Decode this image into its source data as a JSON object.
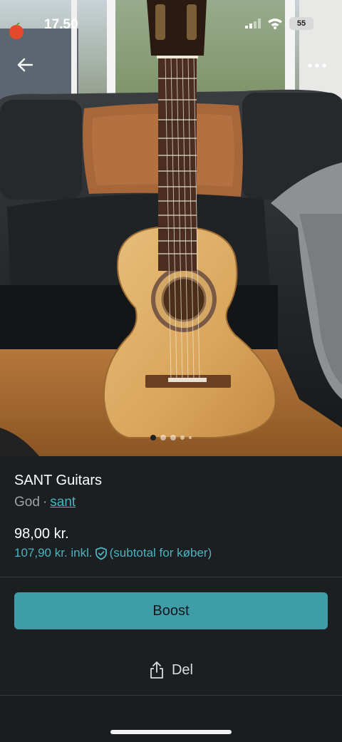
{
  "status_bar": {
    "time": "17.50",
    "battery": "55"
  },
  "nav": {
    "back_icon": "arrow-left-icon",
    "more_icon": "more-dots-icon"
  },
  "gallery": {
    "image_count": 5,
    "active_index": 0
  },
  "listing": {
    "title": "SANT Guitars",
    "condition": "God",
    "separator": "·",
    "brand_link": "sant",
    "price": "98,00 kr.",
    "price_incl": "107,90 kr. inkl.",
    "price_incl_note": "(subtotal for køber)"
  },
  "actions": {
    "boost_label": "Boost",
    "share_label": "Del"
  },
  "colors": {
    "background": "#1b1f22",
    "accent": "#4bb3bf",
    "boost_button": "#3f9da7"
  }
}
